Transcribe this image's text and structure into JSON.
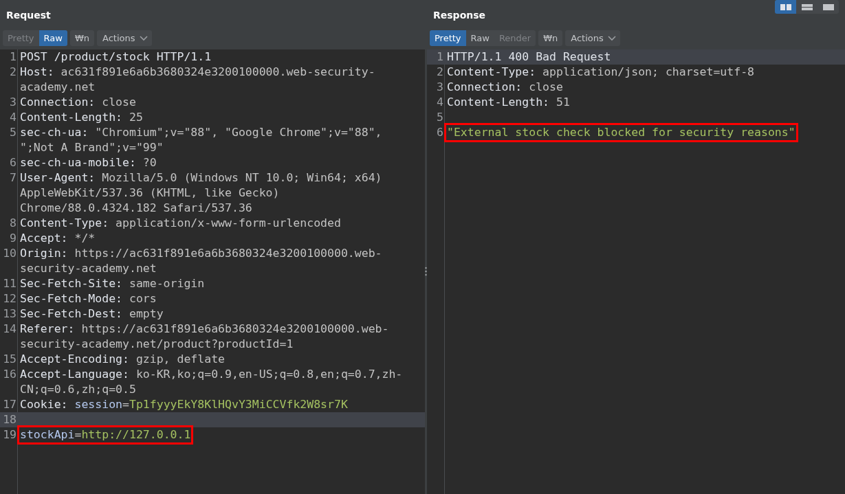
{
  "layout_buttons": [
    {
      "kind": "columns",
      "selected": true
    },
    {
      "kind": "rows",
      "selected": false
    },
    {
      "kind": "single",
      "selected": false
    }
  ],
  "request": {
    "title": "Request",
    "tabs": [
      {
        "label": "Pretty",
        "selected": false,
        "disabled": true
      },
      {
        "label": "Raw",
        "selected": true,
        "disabled": false
      }
    ],
    "wrap_button": "₩n",
    "actions_button": "Actions",
    "lines": [
      {
        "num": "1",
        "current": false,
        "annotated": false,
        "tokens": [
          {
            "kind": "plain",
            "text": "POST /product/stock HTTP/1.1"
          }
        ]
      },
      {
        "num": "2",
        "current": false,
        "annotated": false,
        "tokens": [
          {
            "kind": "key",
            "text": "Host:"
          },
          {
            "kind": "value",
            "text": " ac631f891e6a6b3680324e3200100000.web-security-academy.net"
          }
        ]
      },
      {
        "num": "3",
        "current": false,
        "annotated": false,
        "tokens": [
          {
            "kind": "key",
            "text": "Connection:"
          },
          {
            "kind": "value",
            "text": " close"
          }
        ]
      },
      {
        "num": "4",
        "current": false,
        "annotated": false,
        "tokens": [
          {
            "kind": "key",
            "text": "Content-Length:"
          },
          {
            "kind": "value",
            "text": " 25"
          }
        ]
      },
      {
        "num": "5",
        "current": false,
        "annotated": false,
        "tokens": [
          {
            "kind": "key",
            "text": "sec-ch-ua:"
          },
          {
            "kind": "value",
            "text": " \"Chromium\";v=\"88\", \"Google Chrome\";v=\"88\", \";Not A Brand\";v=\"99\""
          }
        ]
      },
      {
        "num": "6",
        "current": false,
        "annotated": false,
        "tokens": [
          {
            "kind": "key",
            "text": "sec-ch-ua-mobile:"
          },
          {
            "kind": "value",
            "text": " ?0"
          }
        ]
      },
      {
        "num": "7",
        "current": false,
        "annotated": false,
        "tokens": [
          {
            "kind": "key",
            "text": "User-Agent:"
          },
          {
            "kind": "value",
            "text": " Mozilla/5.0 (Windows NT 10.0; Win64; x64) AppleWebKit/537.36 (KHTML, like Gecko) Chrome/88.0.4324.182 Safari/537.36"
          }
        ]
      },
      {
        "num": "8",
        "current": false,
        "annotated": false,
        "tokens": [
          {
            "kind": "key",
            "text": "Content-Type:"
          },
          {
            "kind": "value",
            "text": " application/x-www-form-urlencoded"
          }
        ]
      },
      {
        "num": "9",
        "current": false,
        "annotated": false,
        "tokens": [
          {
            "kind": "key",
            "text": "Accept:"
          },
          {
            "kind": "value",
            "text": " */*"
          }
        ]
      },
      {
        "num": "10",
        "current": false,
        "annotated": false,
        "tokens": [
          {
            "kind": "key",
            "text": "Origin:"
          },
          {
            "kind": "value",
            "text": " https://ac631f891e6a6b3680324e3200100000.web-security-academy.net"
          }
        ]
      },
      {
        "num": "11",
        "current": false,
        "annotated": false,
        "tokens": [
          {
            "kind": "key",
            "text": "Sec-Fetch-Site:"
          },
          {
            "kind": "value",
            "text": " same-origin"
          }
        ]
      },
      {
        "num": "12",
        "current": false,
        "annotated": false,
        "tokens": [
          {
            "kind": "key",
            "text": "Sec-Fetch-Mode:"
          },
          {
            "kind": "value",
            "text": " cors"
          }
        ]
      },
      {
        "num": "13",
        "current": false,
        "annotated": false,
        "tokens": [
          {
            "kind": "key",
            "text": "Sec-Fetch-Dest:"
          },
          {
            "kind": "value",
            "text": " empty"
          }
        ]
      },
      {
        "num": "14",
        "current": false,
        "annotated": false,
        "tokens": [
          {
            "kind": "key",
            "text": "Referer:"
          },
          {
            "kind": "value",
            "text": " https://ac631f891e6a6b3680324e3200100000.web-security-academy.net/product?productId=1"
          }
        ]
      },
      {
        "num": "15",
        "current": false,
        "annotated": false,
        "tokens": [
          {
            "kind": "key",
            "text": "Accept-Encoding:"
          },
          {
            "kind": "value",
            "text": " gzip, deflate"
          }
        ]
      },
      {
        "num": "16",
        "current": false,
        "annotated": false,
        "tokens": [
          {
            "kind": "key",
            "text": "Accept-Language:"
          },
          {
            "kind": "value",
            "text": " ko-KR,ko;q=0.9,en-US;q=0.8,en;q=0.7,zh-CN;q=0.6,zh;q=0.5"
          }
        ]
      },
      {
        "num": "17",
        "current": false,
        "annotated": false,
        "tokens": [
          {
            "kind": "key",
            "text": "Cookie:"
          },
          {
            "kind": "param",
            "text": " session"
          },
          {
            "kind": "value",
            "text": "="
          },
          {
            "kind": "string",
            "text": "Tp1fyyyEkY8KlHQvY3MiCCVfk2W8sr7K"
          }
        ]
      },
      {
        "num": "18",
        "current": true,
        "annotated": false
      },
      {
        "num": "19",
        "current": false,
        "annotated": true,
        "tokens": [
          {
            "kind": "param",
            "text": "stockApi"
          },
          {
            "kind": "value",
            "text": "="
          },
          {
            "kind": "string",
            "text": "http://127.0.0.1"
          }
        ]
      }
    ]
  },
  "response": {
    "title": "Response",
    "tabs": [
      {
        "label": "Pretty",
        "selected": true,
        "disabled": false
      },
      {
        "label": "Raw",
        "selected": false,
        "disabled": false
      },
      {
        "label": "Render",
        "selected": false,
        "disabled": true
      }
    ],
    "wrap_button": "₩n",
    "actions_button": "Actions",
    "lines": [
      {
        "num": "1",
        "current": true,
        "annotated": false,
        "tokens": [
          {
            "kind": "plain",
            "text": "HTTP/1.1 400 Bad Request"
          }
        ]
      },
      {
        "num": "2",
        "current": false,
        "annotated": false,
        "tokens": [
          {
            "kind": "key",
            "text": "Content-Type:"
          },
          {
            "kind": "value",
            "text": " application/json; charset=utf-8"
          }
        ]
      },
      {
        "num": "3",
        "current": false,
        "annotated": false,
        "tokens": [
          {
            "kind": "key",
            "text": "Connection:"
          },
          {
            "kind": "value",
            "text": " close"
          }
        ]
      },
      {
        "num": "4",
        "current": false,
        "annotated": false,
        "tokens": [
          {
            "kind": "key",
            "text": "Content-Length:"
          },
          {
            "kind": "value",
            "text": " 51"
          }
        ]
      },
      {
        "num": "5",
        "current": false,
        "annotated": false
      },
      {
        "num": "6",
        "current": false,
        "annotated": true,
        "tokens": [
          {
            "kind": "string",
            "text": "\"External stock check blocked for security reasons\""
          }
        ]
      }
    ]
  }
}
